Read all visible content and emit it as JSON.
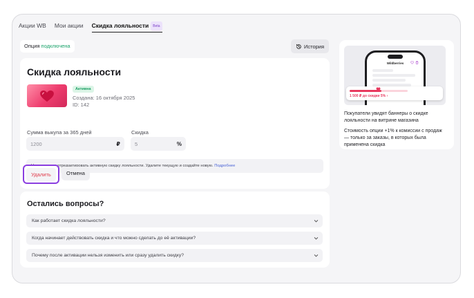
{
  "tabs": [
    {
      "label": "Акции WB",
      "active": false
    },
    {
      "label": "Мои акции",
      "active": false
    },
    {
      "label": "Скидка лояльности",
      "active": true,
      "badge": "Beta"
    }
  ],
  "option": {
    "prefix": "Опция",
    "status": "подключена"
  },
  "history_label": "История",
  "discount": {
    "title": "Скидка лояльности",
    "badge": "Активна",
    "created": "Создана: 16 октября 2025",
    "id": "ID: 142",
    "amount_label": "Сумма выкупа за 365 дней",
    "amount_value": "1200",
    "amount_unit": "₽",
    "discount_label": "Скидка",
    "discount_value": "5",
    "discount_unit": "%",
    "warning": "Не получится отредактировать активную скидку лояльности. Удалите текущую и создайте новую.",
    "warning_link": "Подробнее",
    "delete_label": "Удалить",
    "cancel_label": "Отмена"
  },
  "faq": {
    "title": "Остались вопросы?",
    "items": [
      "Как работает скидка лояльности?",
      "Когда начинает действовать скидка и что можно сделать до её активации?",
      "Почему после активации нельзя изменить или сразу удалить скидку?"
    ]
  },
  "promo": {
    "brand": "Wildberries",
    "banner_text": "1 500 ₽ до скидки 5%",
    "banner_progress": 0.55,
    "text1": "Покупатели увидят баннеры о скидке лояльности на витрине магазина",
    "text2": "Стоимость опции +1% к комиссии с продаж — только за заказы, в которых была применена скидка"
  },
  "colors": {
    "accent_purple": "#8a3de0",
    "danger": "#e03b4a",
    "success": "#1ba36b",
    "link": "#4a63d6",
    "pink": "#e8395f"
  }
}
